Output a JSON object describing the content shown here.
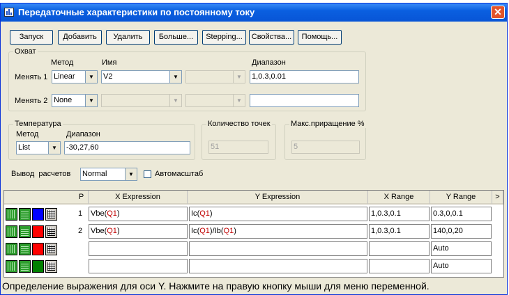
{
  "window": {
    "title": "Передаточные характеристики по постоянному току",
    "close_glyph": "✕"
  },
  "toolbar": [
    {
      "label": "Запуск"
    },
    {
      "label": "Добавить"
    },
    {
      "label": "Удалить"
    },
    {
      "label": "Больше..."
    },
    {
      "label": "Stepping..."
    },
    {
      "label": "Свойства..."
    },
    {
      "label": "Помощь..."
    }
  ],
  "sweep": {
    "legend": "Охват",
    "col_method": "Метод",
    "col_name": "Имя",
    "col_range": "Диапазон",
    "row1": {
      "label": "Менять 1",
      "method": "Linear",
      "name": "V2",
      "range": "1,0.3,0.01"
    },
    "row2": {
      "label": "Менять 2",
      "method": "None",
      "name": "",
      "range": ""
    }
  },
  "temperature": {
    "legend": "Температура",
    "method_label": "Метод",
    "range_label": "Диапазон",
    "method": "List",
    "range": "-30,27,60"
  },
  "points": {
    "legend": "Количество точек",
    "value": "51"
  },
  "max_change": {
    "legend": "Макс.приращение %",
    "value": "5"
  },
  "output": {
    "label": "Вывод  расчетов",
    "value": "Normal",
    "autoscale_label": "Автомасштаб",
    "autoscale_checked": false
  },
  "table": {
    "headers": {
      "p": "P",
      "x_expr": "X Expression",
      "y_expr": "Y Expression",
      "x_range": "X Range",
      "y_range": "Y Range",
      "more": ">"
    },
    "rows": [
      {
        "p": "1",
        "x_fn": "Vbe",
        "x_arg": "Q1",
        "y_parts": [
          "Ic",
          "Q1"
        ],
        "x_range": "1,0.3,0.1",
        "y_range": "0.3,0,0.1",
        "color": "#0000ff"
      },
      {
        "p": "2",
        "x_fn": "Vbe",
        "x_arg": "Q1",
        "y_parts": [
          "Ic",
          "Q1",
          "Ib",
          "Q1"
        ],
        "x_range": "1,0.3,0.1",
        "y_range": "140,0,20",
        "color": "#ff0000"
      },
      {
        "p": "",
        "x_fn": "",
        "x_arg": "",
        "y_parts": [],
        "x_range": "",
        "y_range": "Auto",
        "color": "#ff0000"
      },
      {
        "p": "",
        "x_fn": "",
        "x_arg": "",
        "y_parts": [],
        "x_range": "",
        "y_range": "Auto",
        "color": "#008000"
      }
    ]
  },
  "status": {
    "text": "Определение выражения для оси Y. Нажмите на правую кнопку мыши для меню переменной."
  },
  "icons": {
    "app": "app-icon",
    "close": "close-icon",
    "dropdown": "chevron-down-icon",
    "line_style": "line-style-icon",
    "grid_style": "grid-icon"
  }
}
